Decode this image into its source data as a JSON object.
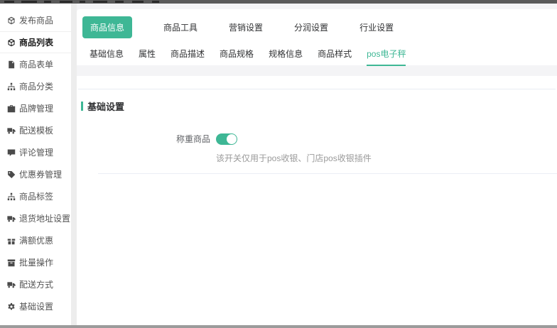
{
  "colors": {
    "accent": "#3eb795",
    "top_strip": "#5a5a5a",
    "bottom_strip": "#9b9b9b",
    "helper_text": "#9a9a9a"
  },
  "sidebar": {
    "items": [
      {
        "label": "发布商品",
        "icon": "cube-icon",
        "active": false
      },
      {
        "label": "商品列表",
        "icon": "cube-icon",
        "active": true
      },
      {
        "label": "商品表单",
        "icon": "file-icon",
        "active": false
      },
      {
        "label": "商品分类",
        "icon": "sitemap-icon",
        "active": false
      },
      {
        "label": "品牌管理",
        "icon": "briefcase-icon",
        "active": false
      },
      {
        "label": "配送模板",
        "icon": "truck-icon",
        "active": false
      },
      {
        "label": "评论管理",
        "icon": "comment-icon",
        "active": false
      },
      {
        "label": "优惠券管理",
        "icon": "tag-icon",
        "active": false
      },
      {
        "label": "商品标签",
        "icon": "sitemap-icon",
        "active": false
      },
      {
        "label": "退货地址设置",
        "icon": "truck-icon",
        "active": false
      },
      {
        "label": "满额优惠",
        "icon": "gift-icon",
        "active": false
      },
      {
        "label": "批量操作",
        "icon": "box-icon",
        "active": false
      },
      {
        "label": "配送方式",
        "icon": "truck-icon",
        "active": false
      },
      {
        "label": "基础设置",
        "icon": "gear-icon",
        "active": false
      }
    ]
  },
  "primary_tabs": [
    {
      "label": "商品信息",
      "active": true
    },
    {
      "label": "商品工具",
      "active": false
    },
    {
      "label": "营销设置",
      "active": false
    },
    {
      "label": "分润设置",
      "active": false
    },
    {
      "label": "行业设置",
      "active": false
    }
  ],
  "secondary_tabs": [
    {
      "label": "基础信息",
      "active": false
    },
    {
      "label": "属性",
      "active": false
    },
    {
      "label": "商品描述",
      "active": false
    },
    {
      "label": "商品规格",
      "active": false
    },
    {
      "label": "规格信息",
      "active": false
    },
    {
      "label": "商品样式",
      "active": false
    },
    {
      "label": "pos电子秤",
      "active": true
    }
  ],
  "content": {
    "section_title": "基础设置",
    "form": {
      "weigh_label": "称重商品",
      "weigh_toggle_on": true,
      "weigh_helper": "该开关仅用于pos收银、门店pos收银插件"
    }
  }
}
